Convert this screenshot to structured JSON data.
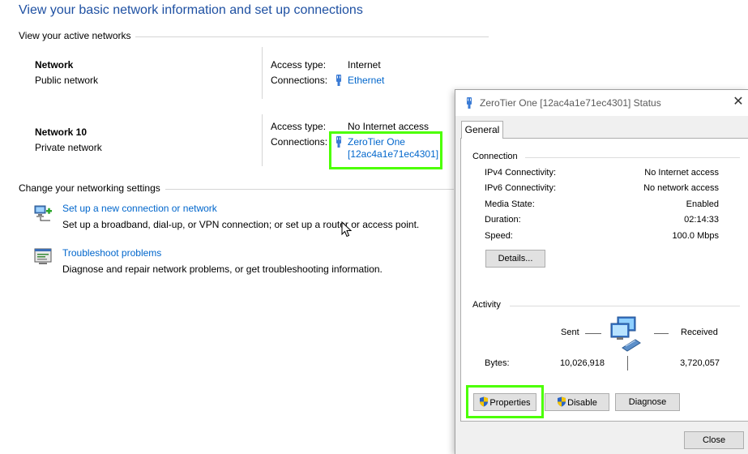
{
  "page": {
    "title": "View your basic network information and set up connections",
    "active_networks_label": "View your active networks",
    "change_settings_label": "Change your networking settings"
  },
  "networks": [
    {
      "name": "Network",
      "type": "Public network",
      "access_type_label": "Access type:",
      "access_type_value": "Internet",
      "connections_label": "Connections:",
      "connection_link": "Ethernet"
    },
    {
      "name": "Network 10",
      "type": "Private network",
      "access_type_label": "Access type:",
      "access_type_value": "No Internet access",
      "connections_label": "Connections:",
      "connection_link_line1": "ZeroTier One",
      "connection_link_line2": "[12ac4a1e71ec4301]"
    }
  ],
  "tasks": [
    {
      "link": "Set up a new connection or network",
      "description": "Set up a broadband, dial-up, or VPN connection; or set up a router or access point.",
      "icon": "new-connection-icon"
    },
    {
      "link": "Troubleshoot problems",
      "description": "Diagnose and repair network problems, or get troubleshooting information.",
      "icon": "troubleshoot-icon"
    }
  ],
  "dialog": {
    "title": "ZeroTier One [12ac4a1e71ec4301] Status",
    "close_glyph": "✕",
    "tab": "General",
    "connection_group": "Connection",
    "connection_rows": [
      {
        "label": "IPv4 Connectivity:",
        "value": "No Internet access"
      },
      {
        "label": "IPv6 Connectivity:",
        "value": "No network access"
      },
      {
        "label": "Media State:",
        "value": "Enabled"
      },
      {
        "label": "Duration:",
        "value": "02:14:33"
      },
      {
        "label": "Speed:",
        "value": "100.0 Mbps"
      }
    ],
    "details_button": "Details...",
    "activity_group": "Activity",
    "sent_label": "Sent",
    "received_label": "Received",
    "bytes_label": "Bytes:",
    "bytes_sent": "10,026,918",
    "bytes_received": "3,720,057",
    "properties_button": "Properties",
    "disable_button": "Disable",
    "diagnose_button": "Diagnose",
    "close_button": "Close"
  },
  "colors": {
    "title_blue": "#1e50a2",
    "link_blue": "#0066cc",
    "highlight_green": "#4cff00"
  }
}
